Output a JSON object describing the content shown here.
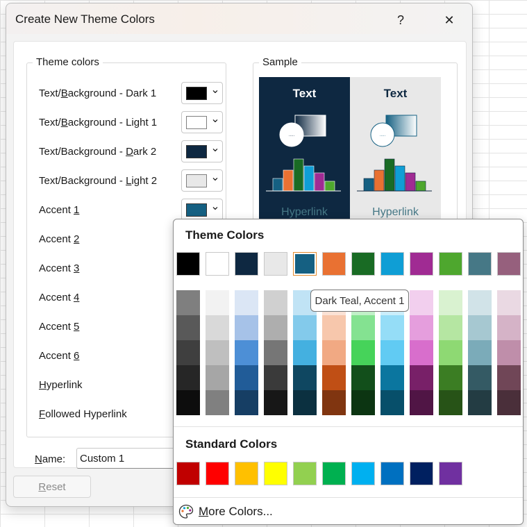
{
  "dialog": {
    "title": "Create New Theme Colors",
    "help_label": "?",
    "close_label": "✕",
    "theme_group_label": "Theme colors",
    "sample_group_label": "Sample",
    "rows": [
      {
        "label_pre": "Text/",
        "label_u": "B",
        "label_post": "ackground - Dark 1",
        "color": "#000000"
      },
      {
        "label_pre": "Text/",
        "label_u": "B",
        "label_post": "ackground - Light 1",
        "color": "#ffffff"
      },
      {
        "label_pre": "Text/Background - ",
        "label_u": "D",
        "label_post": "ark 2",
        "color": "#0e2841"
      },
      {
        "label_pre": "Text/Background - ",
        "label_u": "L",
        "label_post": "ight 2",
        "color": "#e8e8e8"
      },
      {
        "label_pre": "Accent ",
        "label_u": "1",
        "label_post": "",
        "color": "#156082"
      },
      {
        "label_pre": "Accent ",
        "label_u": "2",
        "label_post": ""
      },
      {
        "label_pre": "Accent ",
        "label_u": "3",
        "label_post": ""
      },
      {
        "label_pre": "Accent ",
        "label_u": "4",
        "label_post": ""
      },
      {
        "label_pre": "Accent ",
        "label_u": "5",
        "label_post": ""
      },
      {
        "label_pre": "Accent ",
        "label_u": "6",
        "label_post": ""
      },
      {
        "label_pre": "",
        "label_u": "H",
        "label_post": "yperlink"
      },
      {
        "label_pre": "",
        "label_u": "F",
        "label_post": "ollowed Hyperlink"
      }
    ],
    "sample": {
      "dark_text": "Text",
      "light_text": "Text",
      "dark_link": "Hyperlink",
      "light_link": "Hyperlink"
    },
    "name_label_u": "N",
    "name_label_post": "ame:",
    "name_value": "Custom 1",
    "reset_label_u": "R",
    "reset_label_post": "eset"
  },
  "palette": {
    "theme_heading": "Theme Colors",
    "standard_heading": "Standard Colors",
    "more_colors_u": "M",
    "more_colors_post": "ore Colors...",
    "tooltip": "Dark Teal, Accent 1",
    "selected_index": 4,
    "theme_colors": [
      "#000000",
      "#ffffff",
      "#0e2841",
      "#e8e8e8",
      "#156082",
      "#e97132",
      "#196b24",
      "#0f9ed5",
      "#a02b93",
      "#4ea72e",
      "#467886",
      "#96607d"
    ],
    "tints": [
      [
        "#7f7f7f",
        "#f2f2f2",
        "#dbe6f5",
        "#d0d0d0",
        "#c0e3f5",
        "#fbe2d5",
        "#c1f0c8",
        "#caeefb",
        "#f2cfee",
        "#d9f2d0",
        "#d1e3e8",
        "#ead9e3"
      ],
      [
        "#595959",
        "#d9d9d9",
        "#a6c2e8",
        "#aeaeae",
        "#83caeb",
        "#f7c7ac",
        "#84e291",
        "#95ddf7",
        "#e59edd",
        "#b5e6a2",
        "#a6c8d1",
        "#d5b3c7"
      ],
      [
        "#3f3f3f",
        "#bfbfbf",
        "#4d8fd6",
        "#767676",
        "#44b0e0",
        "#f1a983",
        "#46d35a",
        "#61cbf3",
        "#d86ecc",
        "#8ed973",
        "#7babb9",
        "#bf8eaa"
      ],
      [
        "#262626",
        "#a6a6a6",
        "#215c98",
        "#3a3a3a",
        "#0f4761",
        "#c04f15",
        "#124f1b",
        "#0b769f",
        "#782068",
        "#3b7d23",
        "#345a64",
        "#704657"
      ],
      [
        "#0d0d0d",
        "#808080",
        "#163e64",
        "#171717",
        "#0b3040",
        "#803510",
        "#0c3512",
        "#074f6a",
        "#501545",
        "#275317",
        "#233c43",
        "#4a2f3a"
      ]
    ],
    "standard_colors": [
      "#c00000",
      "#ff0000",
      "#ffc000",
      "#ffff00",
      "#92d050",
      "#00b050",
      "#00b0f0",
      "#0070c0",
      "#002060",
      "#7030a0"
    ]
  }
}
